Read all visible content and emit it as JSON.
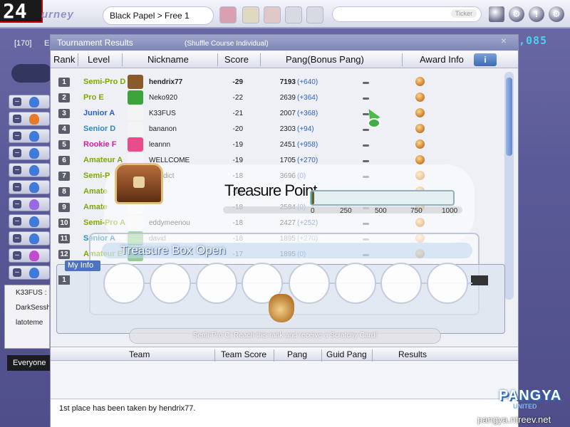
{
  "topbar": {
    "counter": "24",
    "game_title": "urney",
    "course": "Black Papel > Free 1",
    "ticker_label": "Ticker"
  },
  "sidebar": {
    "room_id": "[170]",
    "room_id_suffix": "E",
    "chat_lines": [
      "K33FUS :",
      "DarkSesshd",
      "latoteme"
    ],
    "everyone_label": "Everyone"
  },
  "money": ",085",
  "window": {
    "title": "Tournament Results",
    "subtitle": "(Shuffle Course Individual)",
    "close_icon": "×",
    "columns": [
      "Rank",
      "Level",
      "Nickname",
      "Score",
      "Pang(Bonus Pang)",
      "Award Info"
    ],
    "info_button": "i"
  },
  "results": [
    {
      "rank": "1",
      "level": "Semi-Pro D",
      "level_color": "#7ea800",
      "nick": "hendrix77",
      "score": "-29",
      "pang": "7193",
      "bonus": "(+640)"
    },
    {
      "rank": "2",
      "level": "Pro E",
      "level_color": "#7ea800",
      "nick": "Neko920",
      "score": "-22",
      "pang": "2639",
      "bonus": "(+364)"
    },
    {
      "rank": "3",
      "level": "Junior A",
      "level_color": "#2a5fc8",
      "nick": "K33FUS",
      "score": "-21",
      "pang": "2007",
      "bonus": "(+368)"
    },
    {
      "rank": "4",
      "level": "Senior D",
      "level_color": "#2a8cc0",
      "nick": "bananon",
      "score": "-20",
      "pang": "2303",
      "bonus": "(+94)"
    },
    {
      "rank": "5",
      "level": "Rookie F",
      "level_color": "#d020a0",
      "nick": "leannn",
      "score": "-19",
      "pang": "2451",
      "bonus": "(+958)"
    },
    {
      "rank": "6",
      "level": "Amateur A",
      "level_color": "#7ea800",
      "nick": "WELLCOME",
      "score": "-19",
      "pang": "1705",
      "bonus": "(+270)"
    },
    {
      "rank": "7",
      "level": "Semi-P",
      "level_color": "#7ea800",
      "nick": "e Addict",
      "score": "-18",
      "pang": "3696",
      "bonus": "(0)"
    },
    {
      "rank": "8",
      "level": "Amate",
      "level_color": "#7ea800",
      "nick": "",
      "score": "-18",
      "pang": "",
      "bonus": ""
    },
    {
      "rank": "9",
      "level": "Amate",
      "level_color": "#7ea800",
      "nick": "",
      "score": "-18",
      "pang": "2584",
      "bonus": "(0)"
    },
    {
      "rank": "10",
      "level": "Semi-Pro A",
      "level_color": "#7ea800",
      "nick": "eddymeenou",
      "score": "-18",
      "pang": "2427",
      "bonus": "(+252)"
    },
    {
      "rank": "11",
      "level": "Senior A",
      "level_color": "#2a8cc0",
      "nick": "david",
      "score": "-18",
      "pang": "1895",
      "bonus": "(+270)"
    },
    {
      "rank": "12",
      "level": "Amateur E",
      "level_color": "#7ea800",
      "nick": "",
      "score": "-17",
      "pang": "1895",
      "bonus": "(0)"
    }
  ],
  "treasure": {
    "title": "Treasure Point",
    "progress": 0,
    "scale": [
      "0",
      "250",
      "500",
      "750",
      "1000"
    ],
    "box_open_title": "Treasure Box Open",
    "my_info_label": "My Info",
    "my_rank": "1",
    "hint": "Semi-Pro C: Reach this rank and receive a Scratchy Card!"
  },
  "team_columns": [
    "Team",
    "Team Score",
    "Pang",
    "Guid Pang",
    "Results"
  ],
  "footer": "1st place has been taken by hendrix77.",
  "logo": {
    "title": "PANGYA",
    "sub": "UNITED",
    "url": "pangya.ntreev.net"
  }
}
